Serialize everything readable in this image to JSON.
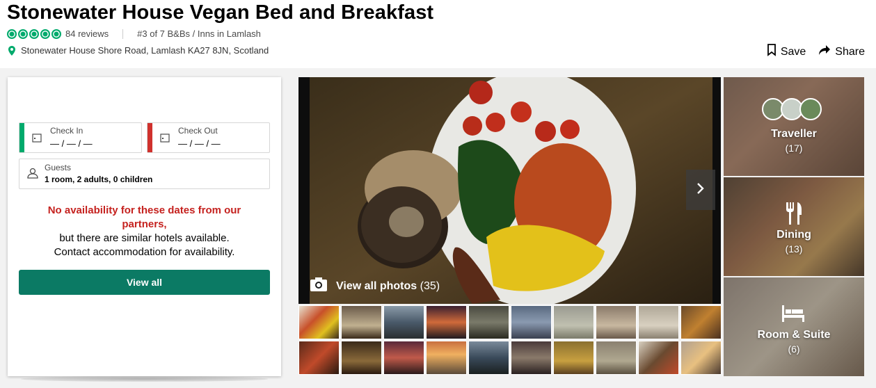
{
  "hotel": {
    "name": "Stonewater House Vegan Bed and Breakfast",
    "rating_bubbles": 5,
    "reviews": "84 reviews",
    "ranking": "#3 of 7 B&Bs / Inns in Lamlash",
    "address": "Stonewater House Shore Road, Lamlash KA27 8JN, Scotland"
  },
  "actions": {
    "save": "Save",
    "share": "Share"
  },
  "booking": {
    "check_in_label": "Check In",
    "check_in_value": "— / — / —",
    "check_out_label": "Check Out",
    "check_out_value": "— / — / —",
    "guests_label": "Guests",
    "guests_value": "1 room, 2 adults, 0 children",
    "no_availability": "No availability for these dates from our partners,",
    "similar_text": "but there are similar hotels available. Contact accommodation for availability.",
    "view_all_button": "View all"
  },
  "gallery": {
    "view_all_photos": "View all photos",
    "photo_count": "(35)"
  },
  "categories": [
    {
      "label": "Traveller",
      "count": "(17)"
    },
    {
      "label": "Dining",
      "count": "(13)"
    },
    {
      "label": "Room & Suite",
      "count": "(6)"
    }
  ],
  "colors": {
    "brand_green": "#00aa6c",
    "button_green": "#0b7a64",
    "warning_red": "#c5221f",
    "check_out_red": "#d0312d"
  }
}
